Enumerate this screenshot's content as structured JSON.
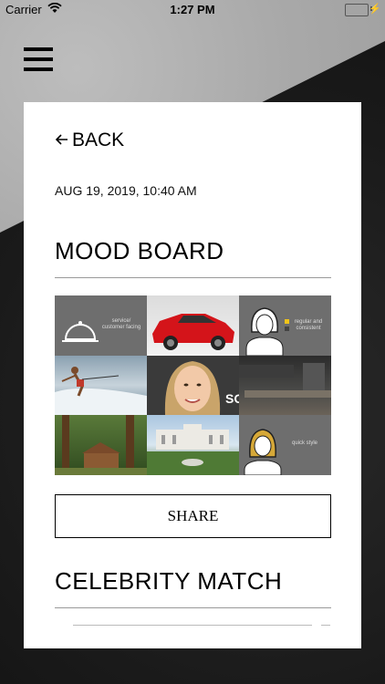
{
  "status": {
    "carrier": "Carrier",
    "time": "1:27 PM"
  },
  "nav": {
    "back_label": "BACK"
  },
  "detail": {
    "date": "AUG 19, 2019, 10:40 AM",
    "mood_title": "MOOD BOARD",
    "share_label": "SHARE",
    "celebrity_title": "CELEBRITY MATCH"
  },
  "moodboard": {
    "tiles": [
      {
        "name": "service-customer-facing",
        "text": "service/\ncustomer facing"
      },
      {
        "name": "red-sports-car",
        "text": ""
      },
      {
        "name": "regular-and-consistent",
        "text": "regular and\nconsistent"
      },
      {
        "name": "water-skiing",
        "text": ""
      },
      {
        "name": "celebrity-portrait",
        "text": ""
      },
      {
        "name": "modern-kitchen",
        "text": ""
      },
      {
        "name": "cabin-in-forest",
        "text": ""
      },
      {
        "name": "mansion-garden",
        "text": ""
      },
      {
        "name": "quick-style",
        "text": "quick style"
      }
    ]
  },
  "colors": {
    "accent": "#000000",
    "tile_gray": "#6f6f6f",
    "battery": "#4cd964"
  }
}
